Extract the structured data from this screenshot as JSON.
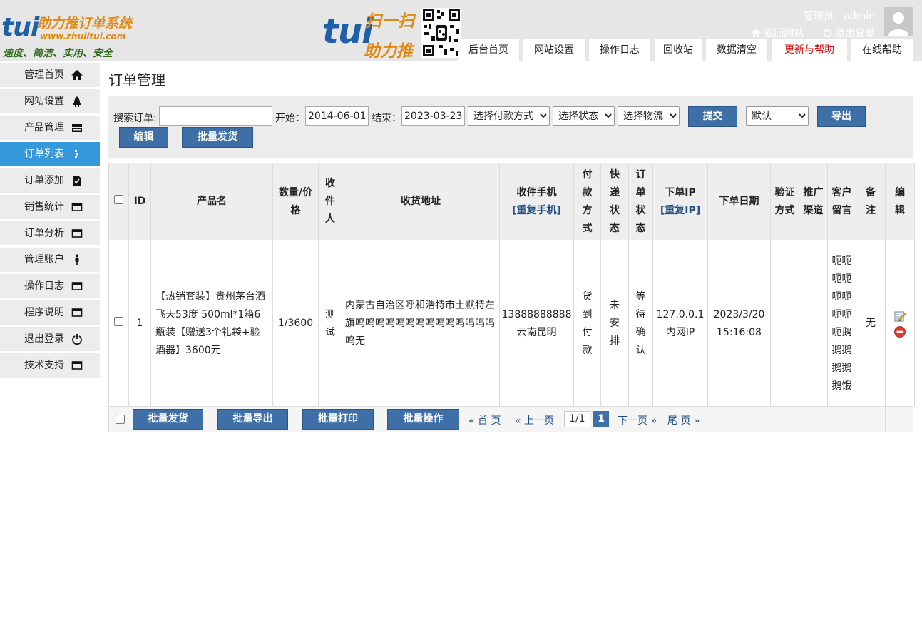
{
  "header": {
    "logo_brand": "tui",
    "logo_title": "助力推订单系统",
    "logo_url": "www.zhulitui.com",
    "logo_slogan": "速度、简洁、实用、安全",
    "scan_brand": "tui",
    "scan_text_1": "扫一扫",
    "scan_text_2": "助力推",
    "admin_label": "管理员：admin",
    "back_site": "返回网站",
    "logout": "退出登录",
    "tabs": [
      {
        "label": "后台首页"
      },
      {
        "label": "网站设置"
      },
      {
        "label": "操作日志"
      },
      {
        "label": "回收站"
      },
      {
        "label": "数据清空"
      },
      {
        "label": "更新与帮助",
        "color": "#d01010"
      },
      {
        "label": "在线帮助"
      }
    ]
  },
  "sidebar": {
    "items": [
      {
        "label": "管理首页",
        "icon": "home-icon"
      },
      {
        "label": "网站设置",
        "icon": "settings-icon"
      },
      {
        "label": "产品管理",
        "icon": "product-icon"
      },
      {
        "label": "订单列表",
        "icon": "list-icon",
        "active": true
      },
      {
        "label": "订单添加",
        "icon": "add-doc-icon"
      },
      {
        "label": "销售统计",
        "icon": "window-icon"
      },
      {
        "label": "订单分析",
        "icon": "window-icon"
      },
      {
        "label": "管理账户",
        "icon": "user-icon"
      },
      {
        "label": "操作日志",
        "icon": "window-icon"
      },
      {
        "label": "程序说明",
        "icon": "window-icon"
      },
      {
        "label": "退出登录",
        "icon": "power-icon"
      },
      {
        "label": "技术支持",
        "icon": "window-icon"
      }
    ]
  },
  "main": {
    "title": "订单管理",
    "search": {
      "search_label": "搜索订单:",
      "search_value": "",
      "start_label": "开始：",
      "start_value": "2014-06-01",
      "end_label": "结束：",
      "end_value": "2023-03-23",
      "payment_select": "选择付款方式",
      "status_select": "选择状态",
      "logistics_select": "选择物流",
      "submit": "提交",
      "sort_select": "默认",
      "export": "导出",
      "edit": "编辑",
      "batch_ship": "批量发货"
    },
    "table": {
      "headers": {
        "id": "ID",
        "product": "产品名",
        "qty_price": "数量/价格",
        "receiver": "收件人",
        "address": "收货地址",
        "phone": "收件手机",
        "phone_dup": "[重复手机]",
        "payment": "付款方式",
        "express_status": "快递状态",
        "order_status": "订单状态",
        "ip": "下单IP",
        "ip_dup": "[重复IP]",
        "order_date": "下单日期",
        "verify": "验证方式",
        "channel": "推广渠道",
        "customer_note": "客户留言",
        "remark": "备注",
        "edit": "编辑"
      },
      "rows": [
        {
          "id": "1",
          "product": "【热销套装】贵州茅台酒飞天53度 500ml*1箱6瓶装【赠送3个礼袋+验酒器】3600元",
          "qty_price": "1/3600",
          "receiver": "测试",
          "address": "内蒙古自治区呼和浩特市土默特左旗呜呜呜呜呜呜呜呜呜呜呜呜呜呜呜无",
          "phone": "13888888888",
          "region": "云南昆明",
          "payment": "货到付款",
          "express_status": "未安排",
          "order_status": "等待确认",
          "ip": "127.0.0.1",
          "ip_type": "内网IP",
          "date": "2023/3/20",
          "time": "15:16:08",
          "verify": "",
          "channel": "",
          "customer_note": "呃呃呃呃呃呃呃呃呃鹅鹅鹅鹅鹅鹅饿",
          "remark": "无"
        }
      ]
    },
    "footer": {
      "batch_ship": "批量发货",
      "batch_export": "批量导出",
      "batch_print": "批量打印",
      "batch_ops": "批量操作",
      "first": "« 首 页",
      "prev": "« 上一页",
      "page_info": "1/1",
      "current_page": "1",
      "next": "下一页 »",
      "last": "尾 页 »"
    }
  }
}
